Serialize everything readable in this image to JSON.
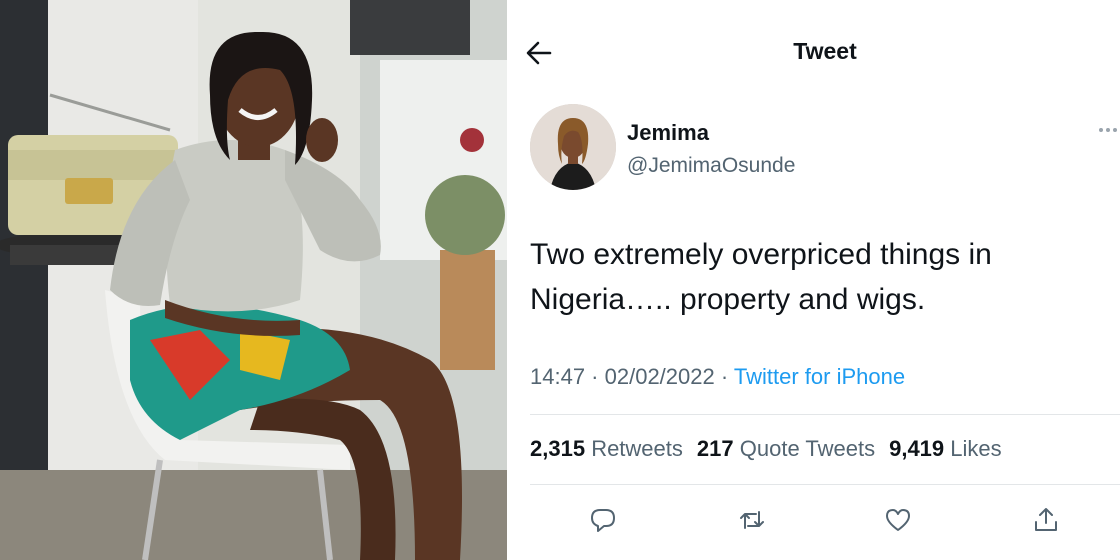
{
  "header": {
    "title": "Tweet",
    "back_icon": "arrow-left-icon"
  },
  "author": {
    "display_name": "Jemima",
    "handle": "@JemimaOsunde"
  },
  "tweet": {
    "text_line1": "Two extremely overpriced things in",
    "text_line2": "Nigeria….. property and wigs.",
    "time": "14:47",
    "separator1": " · ",
    "date": "02/02/2022",
    "separator2": " · ",
    "source": "Twitter for iPhone"
  },
  "stats": {
    "retweets_count": "2,315",
    "retweets_label": "Retweets",
    "quotes_count": "217",
    "quotes_label": "Quote Tweets",
    "likes_count": "9,419",
    "likes_label": "Likes"
  },
  "actions": [
    "reply-icon",
    "retweet-icon",
    "like-icon",
    "share-icon"
  ],
  "colors": {
    "link": "#1d9bf0",
    "secondary_text": "#536471",
    "primary_text": "#0f1419"
  }
}
